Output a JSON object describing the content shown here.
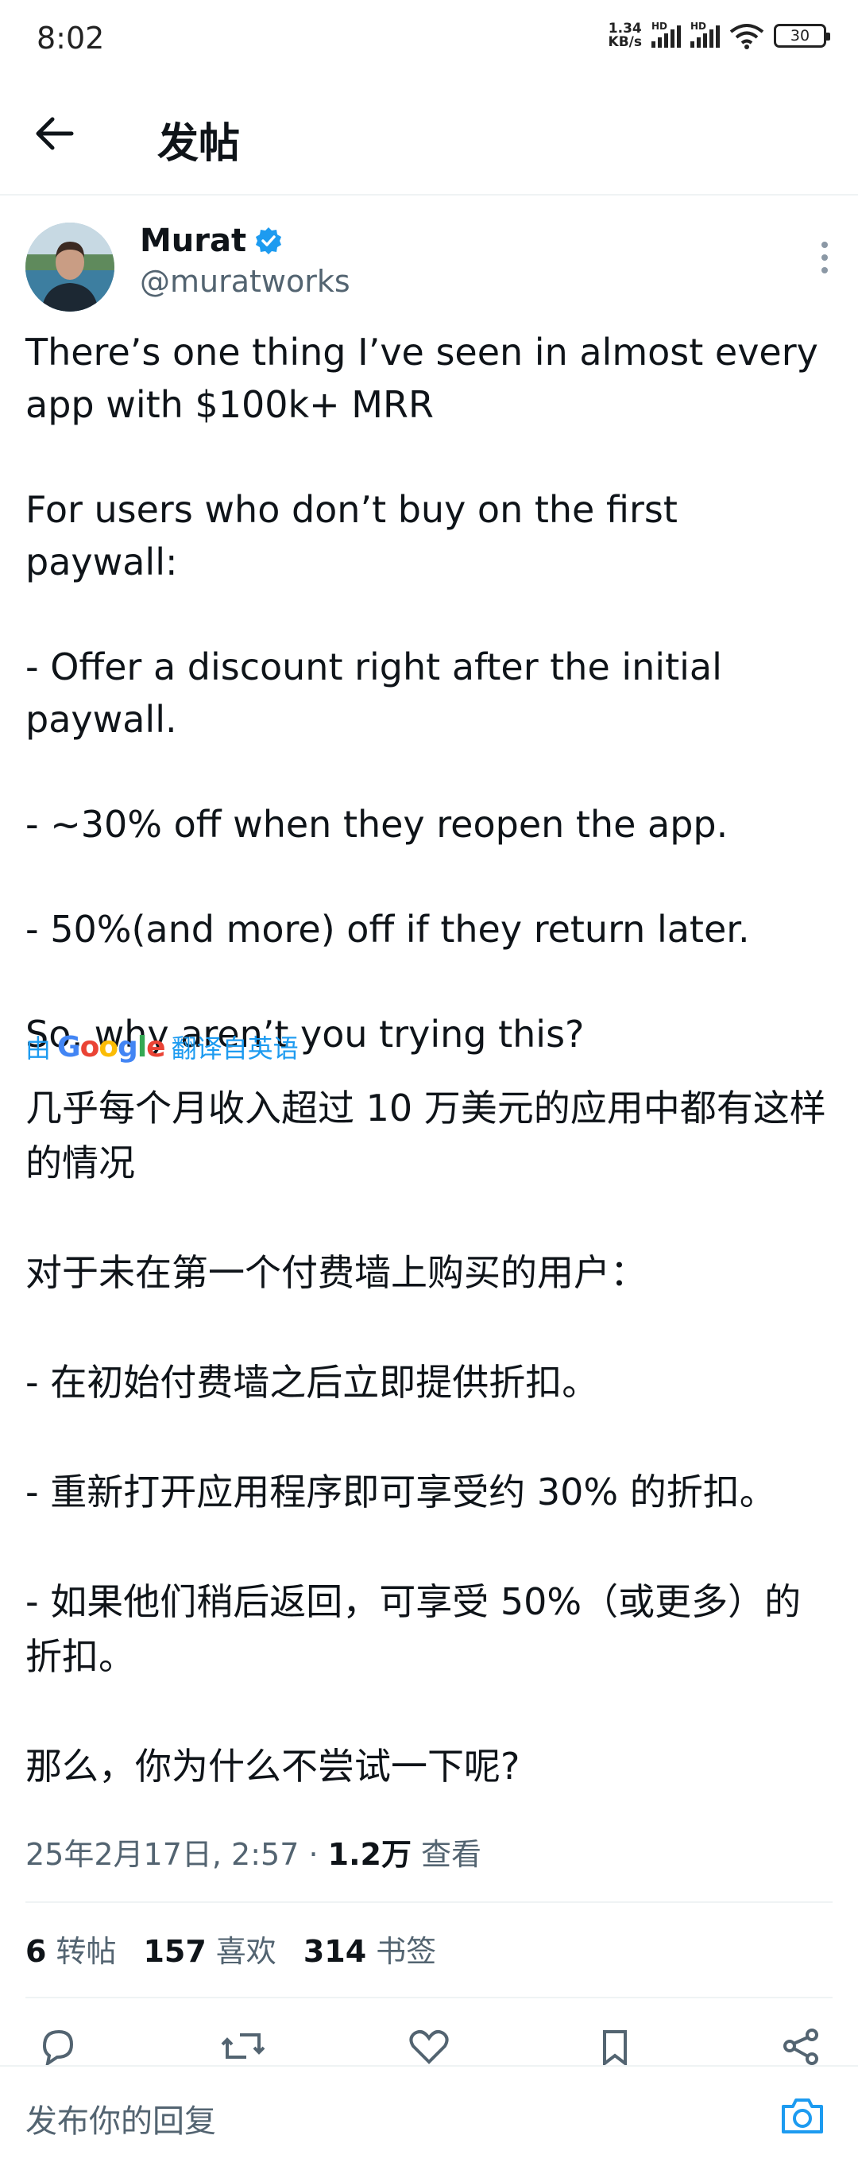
{
  "status_bar": {
    "time": "8:02",
    "net_speed_value": "1.34",
    "net_speed_unit": "KB/s",
    "signal_label_1": "HD",
    "signal_label_2": "HD",
    "battery": "30"
  },
  "header": {
    "title": "发帖"
  },
  "author": {
    "name": "Murat",
    "handle": "@muratworks",
    "verified_color": "#1d9bf0"
  },
  "tweet": {
    "text": "There’s one thing I’ve seen in almost every app with $100k+ MRR\n\nFor users who don’t buy on the first paywall:\n\n- Offer a discount right after the initial paywall.\n\n- ~30% off when they reopen the app.\n\n- 50%(and more) off if they return later.\n\nSo, why aren’t you trying this?",
    "translated_by_prefix": "由",
    "translated_by_brand": "Google",
    "translated_by_suffix": "翻译自英语",
    "translated_text": "几乎每个月收入超过 10 万美元的应用中都有这样的情况\n\n对于未在第一个付费墙上购买的用户：\n\n- 在初始付费墙之后立即提供折扣。\n\n- 重新打开应用程序即可享受约 30% 的折扣。\n\n- 如果他们稍后返回，可享受 50%（或更多）的折扣。\n\n那么，你为什么不尝试一下呢?",
    "timestamp": "25年2月17日, 2:57 · ",
    "views_count": "1.2万",
    "views_label": " 查看"
  },
  "stats": {
    "reposts_count": "6",
    "reposts_label": "转帖",
    "likes_count": "157",
    "likes_label": "喜欢",
    "bookmarks_count": "314",
    "bookmarks_label": "书签"
  },
  "actions": [
    "reply-icon",
    "retweet-icon",
    "like-icon",
    "bookmark-icon",
    "share-icon"
  ],
  "reply_bar": {
    "placeholder": "发布你的回复"
  },
  "colors": {
    "accent": "#1d9bf0",
    "text": "#0f1419",
    "secondary": "#536471",
    "divider": "#eff3f4"
  }
}
